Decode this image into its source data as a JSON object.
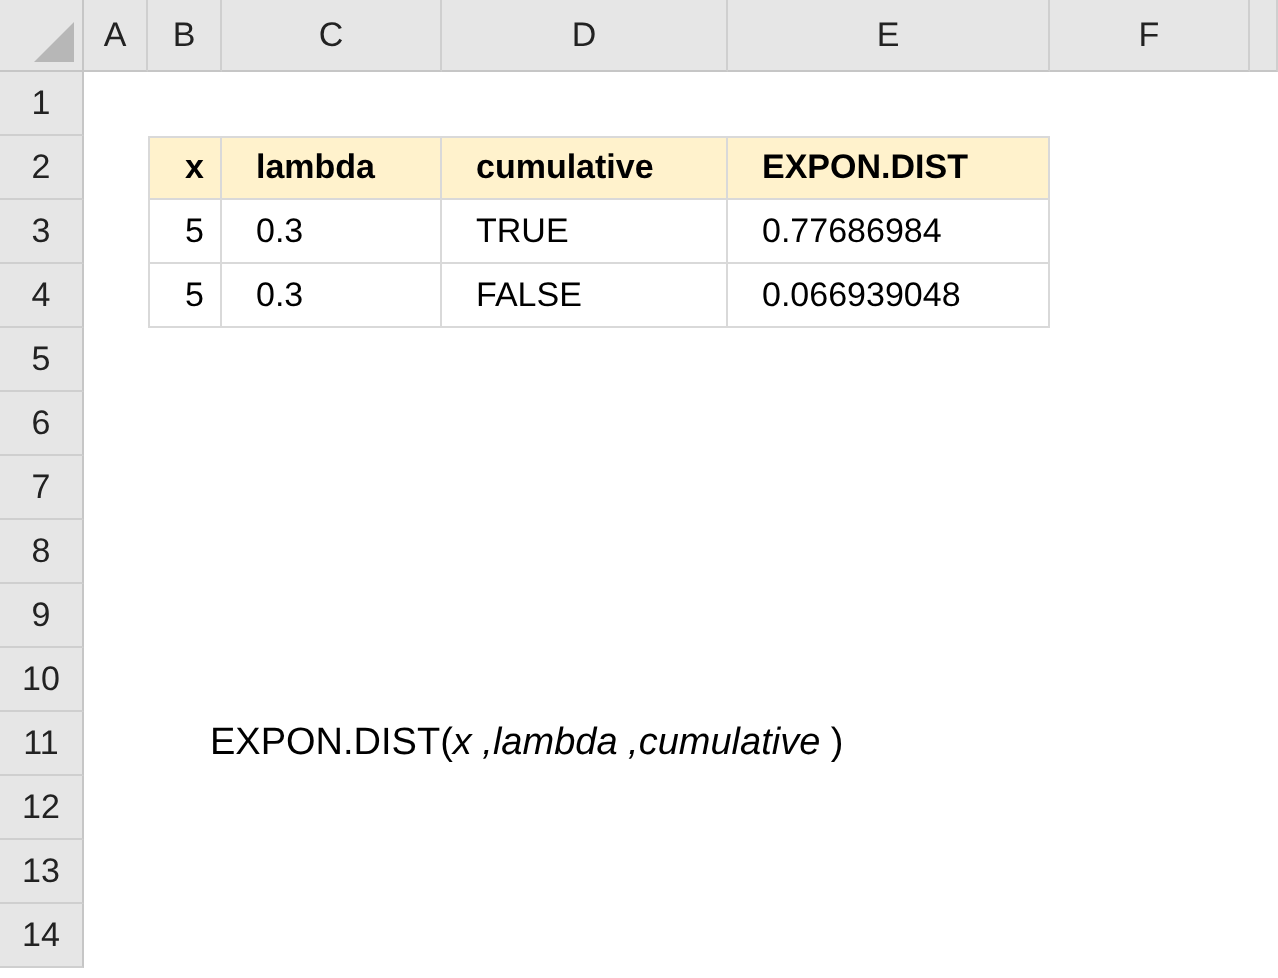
{
  "columns": [
    "A",
    "B",
    "C",
    "D",
    "E",
    "F"
  ],
  "row_numbers": [
    "1",
    "2",
    "3",
    "4",
    "5",
    "6",
    "7",
    "8",
    "9",
    "10",
    "11",
    "12",
    "13",
    "14"
  ],
  "table": {
    "header": [
      "x",
      "lambda",
      "cumulative",
      "EXPON.DIST"
    ],
    "rows": [
      [
        "5",
        "0.3",
        "TRUE",
        "0.77686984"
      ],
      [
        "5",
        "0.3",
        "FALSE",
        "0.066939048"
      ]
    ]
  },
  "formula": "EXPON.DIST(*x ,lambda ,cumulative* )"
}
